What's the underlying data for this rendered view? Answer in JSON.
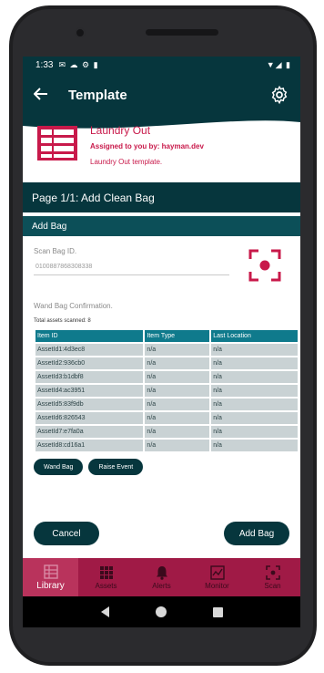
{
  "status_bar": {
    "time": "1:33",
    "left_icons": "✉ ☁ ⚙ ▮",
    "right_icons": "▼◢ ▮"
  },
  "app_bar": {
    "title": "Template"
  },
  "template": {
    "name": "Laundry Out",
    "assigned": "Assigned to you by: hayman.dev",
    "description": "Laundry Out template."
  },
  "page_title": "Page 1/1: Add Clean Bag",
  "section_title": "Add Bag",
  "scan_bag": {
    "label": "Scan Bag ID.",
    "value": "0100887868308338"
  },
  "wand": {
    "label": "Wand Bag Confirmation.",
    "total": "Total assets scanned: 8"
  },
  "table": {
    "headers": [
      "Item ID",
      "Item Type",
      "Last Location"
    ],
    "rows": [
      [
        "AssetId1:4d3ec8",
        "n/a",
        "n/a"
      ],
      [
        "AssetId2:936cb0",
        "n/a",
        "n/a"
      ],
      [
        "AssetId3:b1dbf8",
        "n/a",
        "n/a"
      ],
      [
        "AssetId4:ac3951",
        "n/a",
        "n/a"
      ],
      [
        "AssetId5:83f9db",
        "n/a",
        "n/a"
      ],
      [
        "AssetId6:826543",
        "n/a",
        "n/a"
      ],
      [
        "AssetId7:e7fa0a",
        "n/a",
        "n/a"
      ],
      [
        "AssetId8:cd16a1",
        "n/a",
        "n/a"
      ]
    ]
  },
  "buttons": {
    "wand_bag": "Wand Bag",
    "raise_event": "Raise Event",
    "cancel": "Cancel",
    "add_bag": "Add Bag"
  },
  "nav": {
    "items": [
      {
        "label": "Library",
        "icon": "library-icon",
        "active": true
      },
      {
        "label": "Assets",
        "icon": "assets-grid-icon",
        "active": false
      },
      {
        "label": "Alerts",
        "icon": "bell-icon",
        "active": false
      },
      {
        "label": "Monitor",
        "icon": "monitor-chart-icon",
        "active": false
      },
      {
        "label": "Scan",
        "icon": "scan-icon",
        "active": false
      }
    ]
  },
  "colors": {
    "primary": "#06363d",
    "accent": "#c8194a",
    "nav": "#a01a46",
    "table_header": "#0f7a8c"
  }
}
